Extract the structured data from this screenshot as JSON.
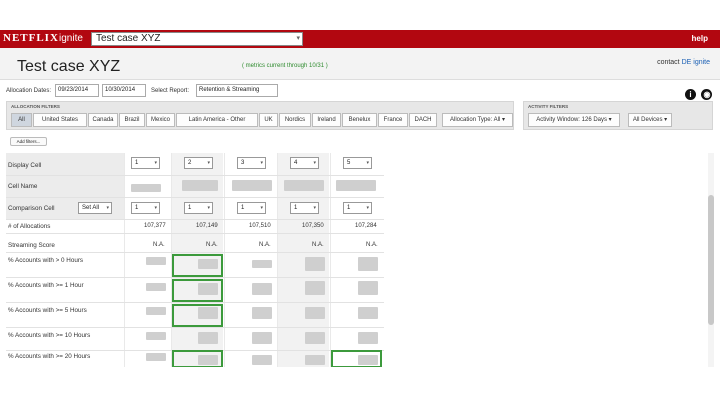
{
  "app": {
    "logo": "NETFLIX",
    "name": "ignite",
    "report": "Test case XYZ",
    "help": "help"
  },
  "header": {
    "title": "Test case XYZ",
    "metrics_note": "( metrics current through 10/31 )",
    "contact_prefix": "contact",
    "contact_link": "DE ignite"
  },
  "dates": {
    "label": "Allocation Dates:",
    "start": "09/23/2014",
    "end": "10/30/2014",
    "report_label": "Select Report:",
    "report_value": "Retention & Streaming"
  },
  "icons": {
    "info": "i",
    "globe": "globe"
  },
  "filters": {
    "title": "ALLOCATION FILTERS",
    "countries": [
      "All",
      "United States",
      "Canada",
      "Brazil",
      "Mexico",
      "Latin America - Other",
      "UK",
      "Nordics",
      "Ireland",
      "Benelux",
      "France",
      "DACH"
    ],
    "allocation_type": "Allocation Type: All"
  },
  "activity": {
    "title": "ACTIVITY FILTERS",
    "window": "Activity Window: 126 Days",
    "devices": "All Devices"
  },
  "add_filters": "Add filters...",
  "grid": {
    "rows": [
      "Display Cell",
      "Cell Name",
      "Comparison Cell",
      "# of Allocations",
      "Streaming Score",
      "% Accounts with > 0 Hours",
      "% Accounts with >= 1 Hour",
      "% Accounts with >= 5 Hours",
      "% Accounts with >= 10 Hours",
      "% Accounts with >= 20 Hours"
    ],
    "set_all": "Set All",
    "display_cells": [
      "1",
      "2",
      "3",
      "4",
      "5"
    ],
    "comparison_cells": [
      "1",
      "1",
      "1",
      "1",
      "1"
    ],
    "allocations": [
      "107,377",
      "107,149",
      "107,510",
      "107,350",
      "107,284"
    ],
    "streaming_scores": [
      "N.A.",
      "N.A.",
      "N.A.",
      "N.A.",
      "N.A."
    ]
  }
}
